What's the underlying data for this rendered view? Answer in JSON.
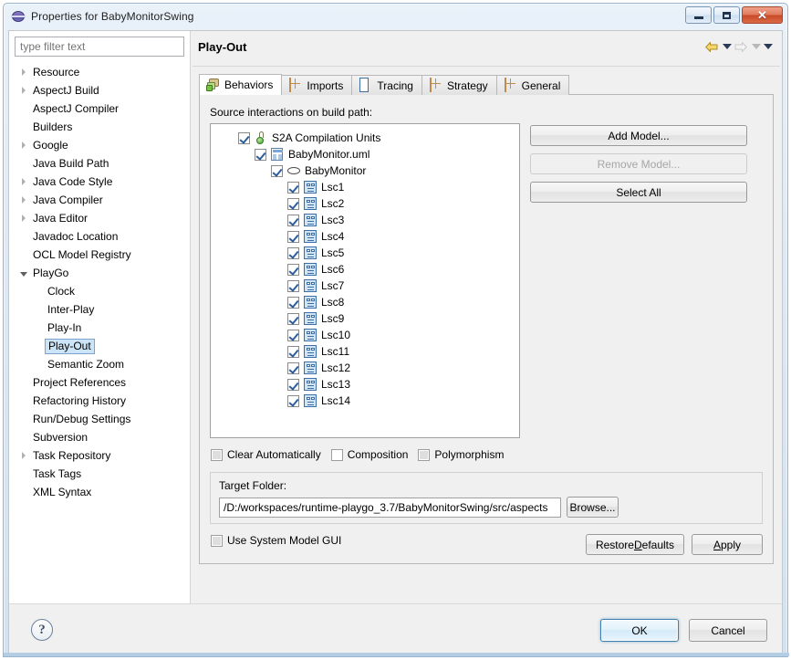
{
  "window": {
    "title": "Properties for BabyMonitorSwing",
    "app_icon": "globe-icon",
    "minimize_label": "Minimize",
    "maximize_label": "Maximize",
    "close_label": "Close",
    "close_glyph": "✕"
  },
  "sidebar": {
    "filter": {
      "value": "",
      "placeholder": "type filter text"
    },
    "items": [
      {
        "label": "Resource",
        "expandable": true,
        "expanded": false,
        "level": 0,
        "selected": false
      },
      {
        "label": "AspectJ Build",
        "expandable": true,
        "expanded": false,
        "level": 0,
        "selected": false
      },
      {
        "label": "AspectJ Compiler",
        "expandable": false,
        "expanded": false,
        "level": 0,
        "selected": false
      },
      {
        "label": "Builders",
        "expandable": false,
        "expanded": false,
        "level": 0,
        "selected": false
      },
      {
        "label": "Google",
        "expandable": true,
        "expanded": false,
        "level": 0,
        "selected": false
      },
      {
        "label": "Java Build Path",
        "expandable": false,
        "expanded": false,
        "level": 0,
        "selected": false
      },
      {
        "label": "Java Code Style",
        "expandable": true,
        "expanded": false,
        "level": 0,
        "selected": false
      },
      {
        "label": "Java Compiler",
        "expandable": true,
        "expanded": false,
        "level": 0,
        "selected": false
      },
      {
        "label": "Java Editor",
        "expandable": true,
        "expanded": false,
        "level": 0,
        "selected": false
      },
      {
        "label": "Javadoc Location",
        "expandable": false,
        "expanded": false,
        "level": 0,
        "selected": false
      },
      {
        "label": "OCL Model Registry",
        "expandable": false,
        "expanded": false,
        "level": 0,
        "selected": false
      },
      {
        "label": "PlayGo",
        "expandable": true,
        "expanded": true,
        "level": 0,
        "selected": false
      },
      {
        "label": "Clock",
        "expandable": false,
        "expanded": false,
        "level": 1,
        "selected": false
      },
      {
        "label": "Inter-Play",
        "expandable": false,
        "expanded": false,
        "level": 1,
        "selected": false
      },
      {
        "label": "Play-In",
        "expandable": false,
        "expanded": false,
        "level": 1,
        "selected": false
      },
      {
        "label": "Play-Out",
        "expandable": false,
        "expanded": false,
        "level": 1,
        "selected": true
      },
      {
        "label": "Semantic Zoom",
        "expandable": false,
        "expanded": false,
        "level": 1,
        "selected": false
      },
      {
        "label": "Project References",
        "expandable": false,
        "expanded": false,
        "level": 0,
        "selected": false
      },
      {
        "label": "Refactoring History",
        "expandable": false,
        "expanded": false,
        "level": 0,
        "selected": false
      },
      {
        "label": "Run/Debug Settings",
        "expandable": false,
        "expanded": false,
        "level": 0,
        "selected": false
      },
      {
        "label": "Subversion",
        "expandable": false,
        "expanded": false,
        "level": 0,
        "selected": false
      },
      {
        "label": "Task Repository",
        "expandable": true,
        "expanded": false,
        "level": 0,
        "selected": false
      },
      {
        "label": "Task Tags",
        "expandable": false,
        "expanded": false,
        "level": 0,
        "selected": false
      },
      {
        "label": "XML Syntax",
        "expandable": false,
        "expanded": false,
        "level": 0,
        "selected": false
      }
    ]
  },
  "content": {
    "page_title": "Play-Out",
    "nav": {
      "back_label": "Back",
      "back_menu_label": "Back history",
      "forward_label": "Forward",
      "forward_menu_label": "Forward history",
      "menu_label": "View menu"
    },
    "tabs": [
      {
        "label": "Behaviors",
        "icon": "behaviors-icon",
        "active": true
      },
      {
        "label": "Imports",
        "icon": "grid-icon",
        "active": false
      },
      {
        "label": "Tracing",
        "icon": "tracing-icon",
        "active": false
      },
      {
        "label": "Strategy",
        "icon": "grid-icon",
        "active": false
      },
      {
        "label": "General",
        "icon": "grid-icon",
        "active": false
      }
    ],
    "source_label": "Source interactions on build path:",
    "model_tree": [
      {
        "label": "S2A Compilation Units",
        "level": 0,
        "checked": true,
        "icon": "s2a-icon"
      },
      {
        "label": "BabyMonitor.uml",
        "level": 1,
        "checked": true,
        "icon": "uml-file-icon"
      },
      {
        "label": "BabyMonitor",
        "level": 2,
        "checked": true,
        "icon": "ellipse-icon"
      },
      {
        "label": "Lsc1",
        "level": 3,
        "checked": true,
        "icon": "lsc-icon"
      },
      {
        "label": "Lsc2",
        "level": 3,
        "checked": true,
        "icon": "lsc-icon"
      },
      {
        "label": "Lsc3",
        "level": 3,
        "checked": true,
        "icon": "lsc-icon"
      },
      {
        "label": "Lsc4",
        "level": 3,
        "checked": true,
        "icon": "lsc-icon"
      },
      {
        "label": "Lsc5",
        "level": 3,
        "checked": true,
        "icon": "lsc-icon"
      },
      {
        "label": "Lsc6",
        "level": 3,
        "checked": true,
        "icon": "lsc-icon"
      },
      {
        "label": "Lsc7",
        "level": 3,
        "checked": true,
        "icon": "lsc-icon"
      },
      {
        "label": "Lsc8",
        "level": 3,
        "checked": true,
        "icon": "lsc-icon"
      },
      {
        "label": "Lsc9",
        "level": 3,
        "checked": true,
        "icon": "lsc-icon"
      },
      {
        "label": "Lsc10",
        "level": 3,
        "checked": true,
        "icon": "lsc-icon"
      },
      {
        "label": "Lsc11",
        "level": 3,
        "checked": true,
        "icon": "lsc-icon"
      },
      {
        "label": "Lsc12",
        "level": 3,
        "checked": true,
        "icon": "lsc-icon"
      },
      {
        "label": "Lsc13",
        "level": 3,
        "checked": true,
        "icon": "lsc-icon"
      },
      {
        "label": "Lsc14",
        "level": 3,
        "checked": true,
        "icon": "lsc-icon"
      }
    ],
    "side_buttons": [
      {
        "label": "Add Model...",
        "enabled": true
      },
      {
        "label": "Remove Model...",
        "enabled": false
      },
      {
        "label": "Select All",
        "enabled": true
      }
    ],
    "options": [
      {
        "label": "Clear Automatically",
        "checked": false
      },
      {
        "label": "Composition",
        "checked": false
      },
      {
        "label": "Polymorphism",
        "checked": false
      }
    ],
    "target": {
      "group_label": "Target Folder:",
      "path": "/D:/workspaces/runtime-playgo_3.7/BabyMonitorSwing/src/aspects",
      "browse_label": "Browse..."
    },
    "system_gui": {
      "label": "Use System Model GUI",
      "checked": false
    },
    "restore_defaults": {
      "pre": "Restore ",
      "mnemonic": "D",
      "post": "efaults"
    },
    "apply": {
      "pre": "",
      "mnemonic": "A",
      "post": "pply"
    }
  },
  "footer": {
    "help_label": "?",
    "ok_label": "OK",
    "cancel_label": "Cancel"
  },
  "colors": {
    "accent": "#3c7fb1",
    "titlebar_start": "#e9f1f9",
    "close_red": "#c84a28",
    "selection_blue": "#cce4f7",
    "lsc_icon_blue": "#3a6ea5"
  }
}
